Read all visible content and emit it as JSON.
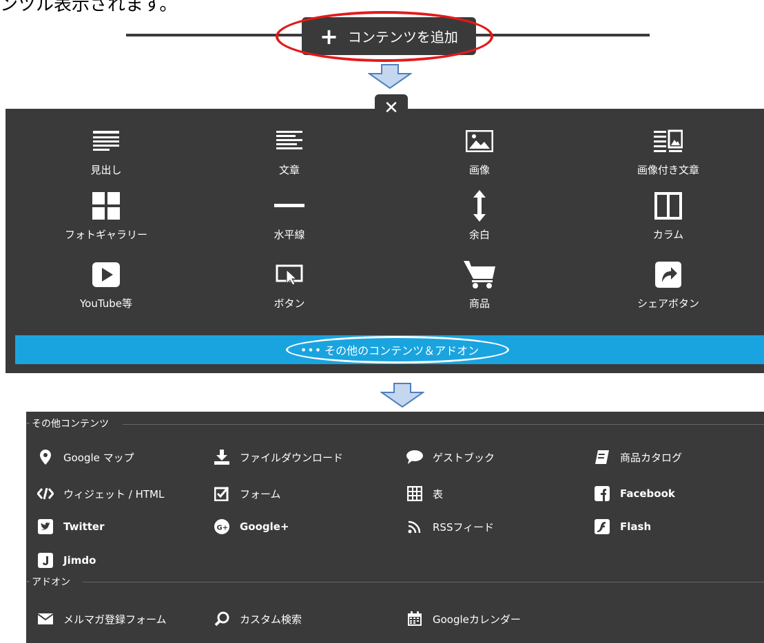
{
  "header_fragment": "ンツル表示されます。",
  "add_button": {
    "plus": "+",
    "label": "コンテンツを追加"
  },
  "close_icon": "✕",
  "grid": [
    {
      "label": "見出し",
      "icon": "heading-icon"
    },
    {
      "label": "文章",
      "icon": "text-icon"
    },
    {
      "label": "画像",
      "icon": "image-icon"
    },
    {
      "label": "画像付き文章",
      "icon": "text-with-image-icon"
    },
    {
      "label": "フォトギャラリー",
      "icon": "gallery-icon"
    },
    {
      "label": "水平線",
      "icon": "horizontal-line-icon"
    },
    {
      "label": "余白",
      "icon": "spacer-icon"
    },
    {
      "label": "カラム",
      "icon": "columns-icon"
    },
    {
      "label": "YouTube等",
      "icon": "video-icon"
    },
    {
      "label": "ボタン",
      "icon": "button-icon"
    },
    {
      "label": "商品",
      "icon": "cart-icon"
    },
    {
      "label": "シェアボタン",
      "icon": "share-icon"
    }
  ],
  "more_bar": {
    "dots": "•••",
    "label": "その他のコンテンツ＆アドオン"
  },
  "other_content": {
    "title": "その他コンテンツ",
    "items": [
      {
        "label": "Google マップ",
        "icon": "map-pin-icon"
      },
      {
        "label": "ファイルダウンロード",
        "icon": "download-icon"
      },
      {
        "label": "ゲストブック",
        "icon": "speech-bubble-icon"
      },
      {
        "label": "商品カタログ",
        "icon": "catalog-icon"
      },
      {
        "label": "ウィジェット / HTML",
        "icon": "code-icon"
      },
      {
        "label": "フォーム",
        "icon": "form-check-icon"
      },
      {
        "label": "表",
        "icon": "table-icon"
      },
      {
        "label": "Facebook",
        "icon": "facebook-icon"
      },
      {
        "label": "Twitter",
        "icon": "twitter-icon"
      },
      {
        "label": "Google+",
        "icon": "google-plus-icon"
      },
      {
        "label": "RSSフィード",
        "icon": "rss-icon"
      },
      {
        "label": "Flash",
        "icon": "flash-icon"
      },
      {
        "label": "Jimdo",
        "icon": "jimdo-icon"
      }
    ]
  },
  "addons": {
    "title": "アドオン",
    "items": [
      {
        "label": "メルマガ登録フォーム",
        "icon": "envelope-icon"
      },
      {
        "label": "カスタム検索",
        "icon": "search-icon"
      },
      {
        "label": "Googleカレンダー",
        "icon": "calendar-icon"
      }
    ]
  },
  "colors": {
    "panel": "#3a3a3a",
    "accent_blue": "#1aa4df",
    "highlight_red": "#e21a1a",
    "arrow_fill": "#c5d7ee",
    "arrow_stroke": "#4f7fbf"
  }
}
